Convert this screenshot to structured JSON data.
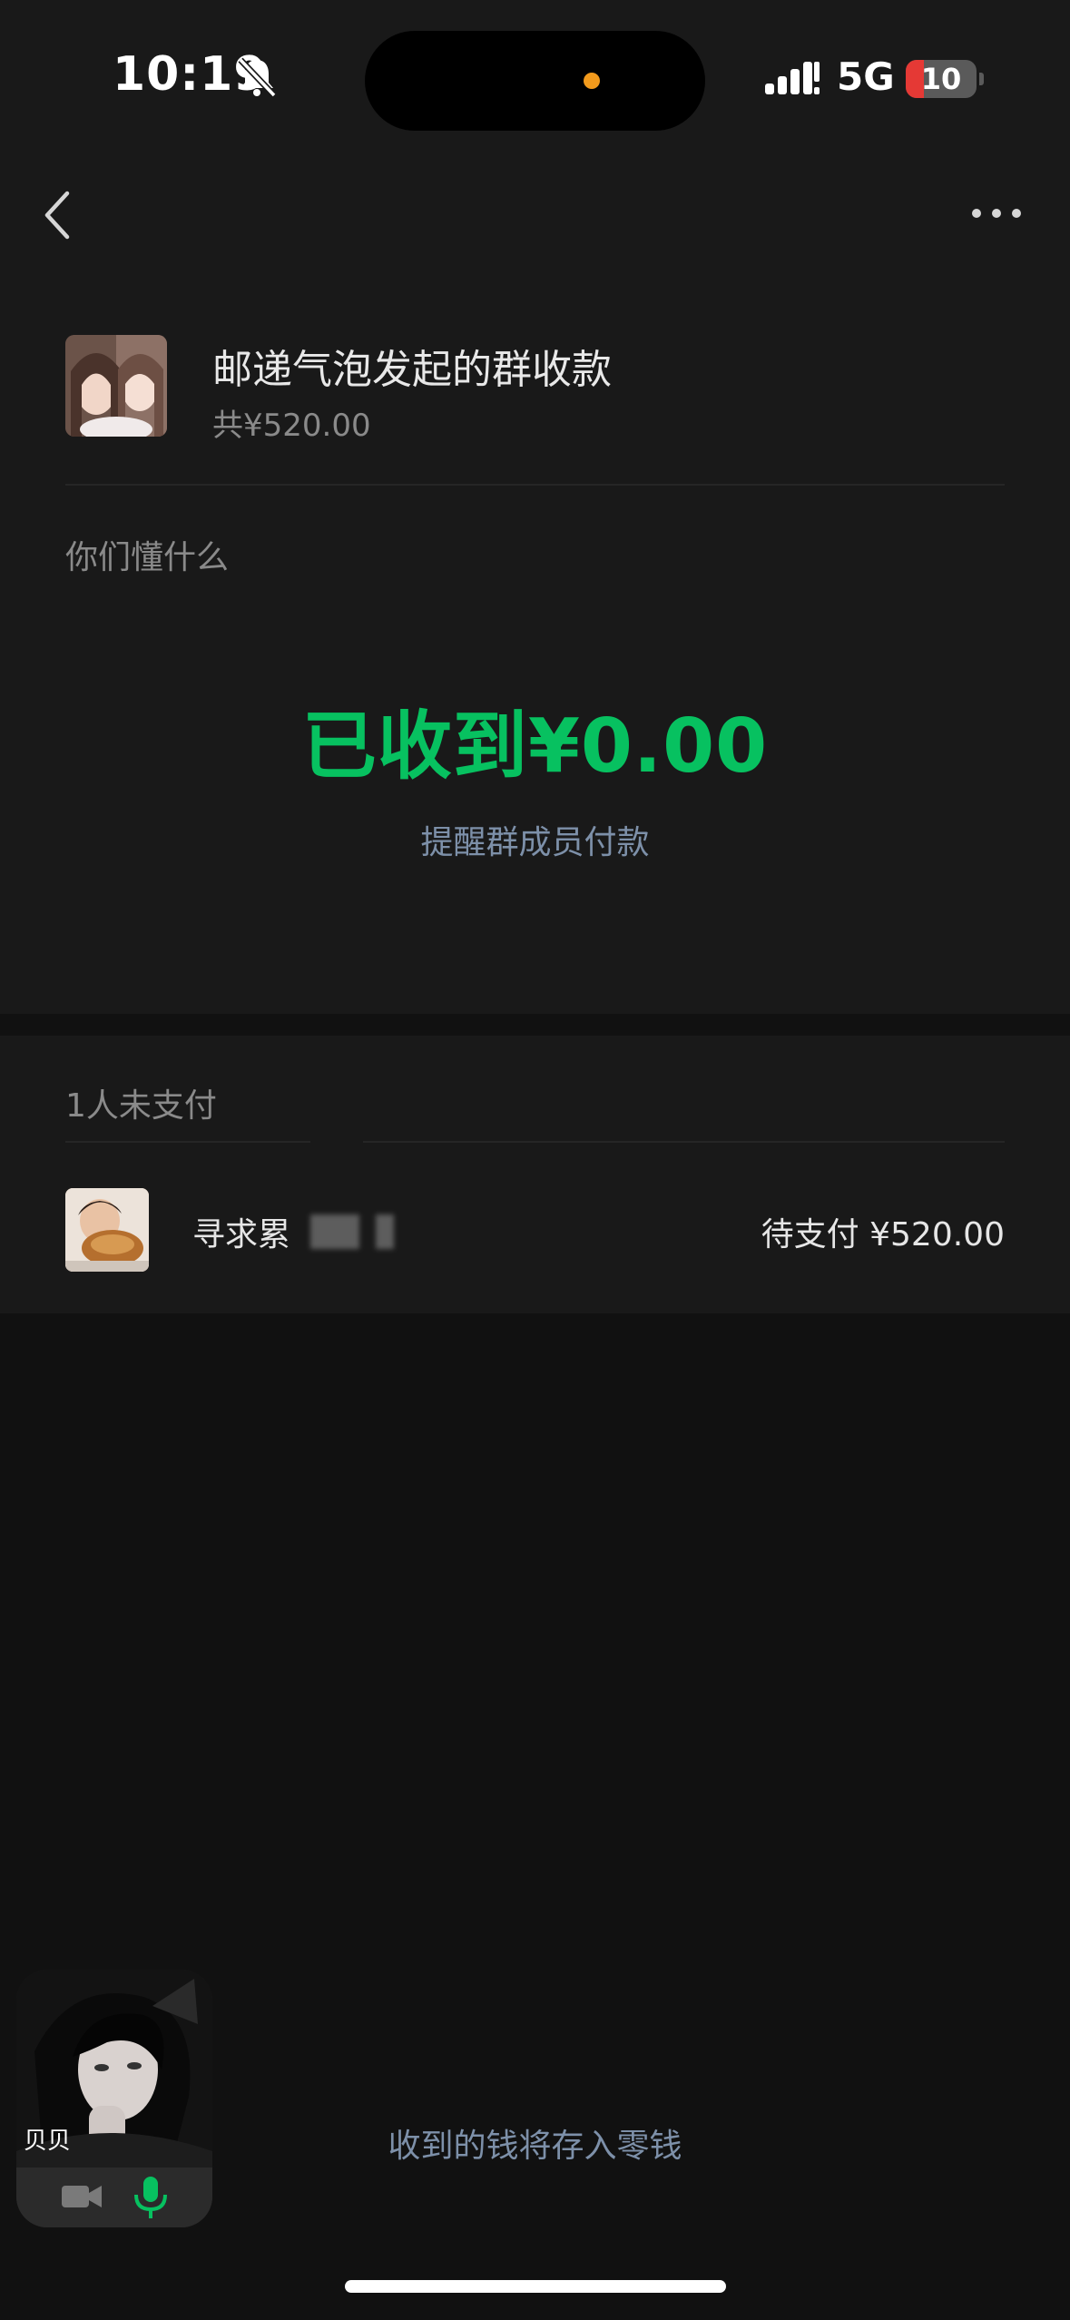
{
  "status_bar": {
    "time": "10:19",
    "network": "5G",
    "battery_level": "10",
    "battery_fraction": 0.1,
    "icons": [
      "bell-slash-icon",
      "signal-icon",
      "battery-charging-icon"
    ]
  },
  "nav": {
    "back_icon": "chevron-left-icon",
    "more_icon": "ellipsis-icon"
  },
  "request": {
    "title": "邮递气泡发起的群收款",
    "total": "共¥520.00",
    "note": "你们懂什么",
    "received": "已收到¥0.00",
    "remind_label": "提醒群成员付款"
  },
  "unpaid": {
    "count_label": "1人未支付",
    "members": [
      {
        "name": "寻求累",
        "status": "待支付 ¥520.00"
      }
    ]
  },
  "call": {
    "caller": "贝贝",
    "icons": [
      "video-camera-icon",
      "microphone-icon"
    ]
  },
  "footer": {
    "text": "收到的钱将存入零钱"
  },
  "colors": {
    "accent_green": "#07c160",
    "link_blue": "#7d90a9",
    "background": "#111111",
    "card": "#191919"
  }
}
